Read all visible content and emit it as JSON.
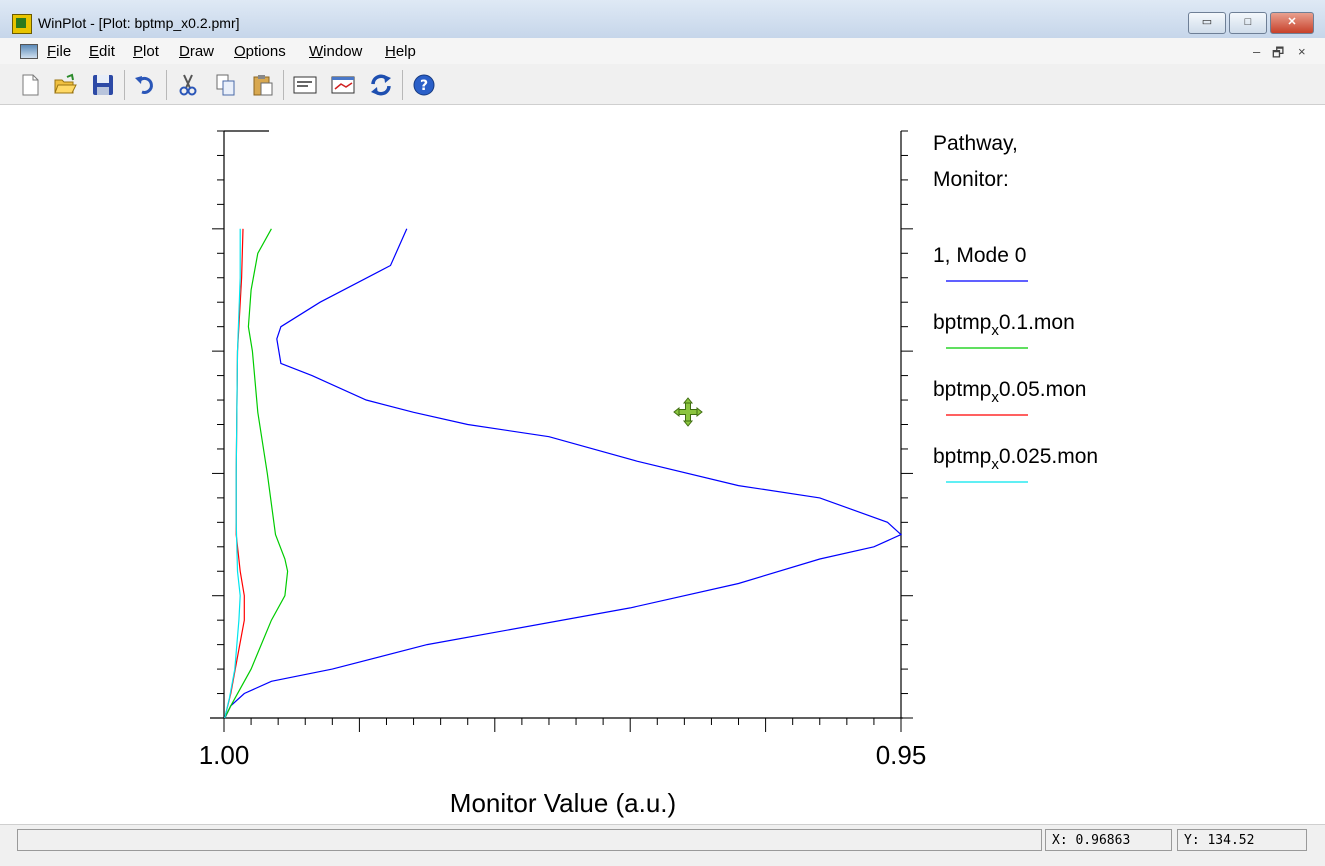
{
  "window": {
    "title": "WinPlot - [Plot: bptmp_x0.2.pmr]",
    "minimize_glyph": "▭",
    "maximize_glyph": "□",
    "close_glyph": "✕",
    "mdi_minimize": "–",
    "mdi_restore": "🗗",
    "mdi_close": "×"
  },
  "menu": {
    "items": [
      {
        "key": "F",
        "rest": "ile"
      },
      {
        "key": "E",
        "rest": "dit"
      },
      {
        "key": "P",
        "rest": "lot"
      },
      {
        "key": "D",
        "rest": "raw"
      },
      {
        "key": "O",
        "rest": "ptions"
      },
      {
        "key": "W",
        "rest": "indow"
      },
      {
        "key": "H",
        "rest": "elp"
      }
    ]
  },
  "toolbar": {
    "icons": [
      "new-file-icon",
      "open-folder-icon",
      "save-disk-icon",
      "undo-icon",
      "cut-scissors-icon",
      "copy-icon",
      "paste-clipboard-icon",
      "properties-icon",
      "graph-window-icon",
      "refresh-icon",
      "help-icon"
    ]
  },
  "cursor_icon": "move-cross-icon",
  "status": {
    "main": "",
    "x": "X: 0.96863",
    "y": "Y: 134.52"
  },
  "chart_data": {
    "type": "line",
    "title": "",
    "xlabel": "Monitor Value (a.u.)",
    "ylabel": "",
    "xlim": [
      1.0,
      0.95
    ],
    "ylim": [
      0,
      240
    ],
    "x_tick_labels": [
      {
        "value": 1.0,
        "label": "1.00"
      },
      {
        "value": 0.95,
        "label": "0.95"
      }
    ],
    "legend_title": [
      "Pathway,",
      "Monitor:"
    ],
    "legend_position": "right",
    "series": [
      {
        "name": "1, Mode 0",
        "color": "#0000ff",
        "x": [
          0.99993,
          0.9995,
          0.9985,
          0.9965,
          0.992,
          0.985,
          0.97,
          0.962,
          0.956,
          0.952,
          0.95,
          0.951,
          0.956,
          0.962,
          0.9695,
          0.976,
          0.982,
          0.986,
          0.9895,
          0.9935,
          0.9958,
          0.9961,
          0.9958,
          0.9929,
          0.9877,
          0.9865
        ],
        "y": [
          0,
          5,
          10,
          15,
          20,
          30,
          45,
          55,
          65,
          70,
          75,
          80,
          90,
          95,
          105,
          115,
          120,
          125,
          130,
          140,
          145,
          155,
          160,
          170,
          185,
          200
        ]
      },
      {
        "name": "bptmp_x0.1.mon",
        "color": "#00cc00",
        "x": [
          0.99995,
          0.9995,
          0.998,
          0.9965,
          0.9955,
          0.9953,
          0.9955,
          0.9962,
          0.9968,
          0.9975,
          0.9979,
          0.9982,
          0.998,
          0.9975,
          0.9965
        ],
        "y": [
          0,
          5,
          20,
          40,
          50,
          60,
          65,
          75,
          100,
          125,
          150,
          160,
          175,
          190,
          200
        ]
      },
      {
        "name": "bptmp_x0.05.mon",
        "color": "#ff0000",
        "x": [
          0.99995,
          0.9995,
          0.999,
          0.9985,
          0.9985,
          0.9988,
          0.9991,
          0.9991,
          0.999,
          0.9987,
          0.9986
        ],
        "y": [
          0,
          10,
          25,
          40,
          50,
          60,
          75,
          100,
          150,
          180,
          200
        ]
      },
      {
        "name": "bptmp_x0.025.mon",
        "color": "#00e5ee",
        "x": [
          0.99995,
          0.9996,
          0.9992,
          0.9989,
          0.9988,
          0.999,
          0.9991,
          0.9991,
          0.999,
          0.9988,
          0.9988
        ],
        "y": [
          0,
          8,
          20,
          40,
          50,
          60,
          80,
          100,
          150,
          180,
          200
        ]
      }
    ]
  }
}
